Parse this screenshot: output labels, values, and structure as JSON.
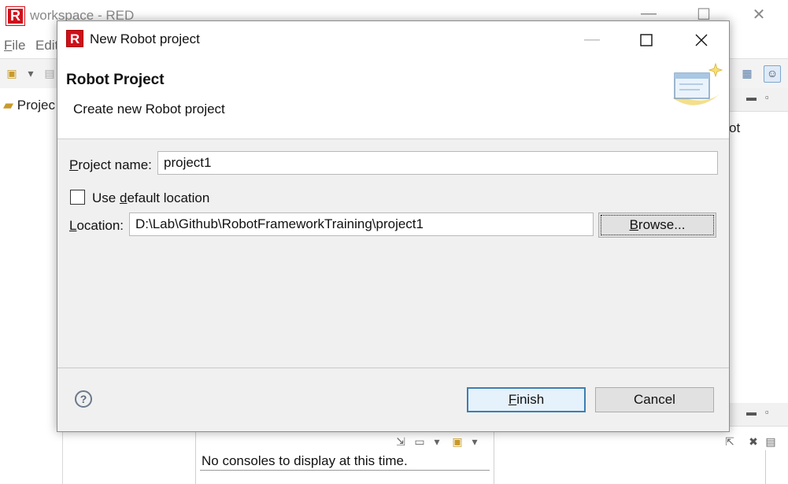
{
  "background_window": {
    "logo_letter": "R",
    "title": "workspace - RED",
    "menu": [
      {
        "label": "File",
        "ul": "F",
        "rest": "ile"
      },
      {
        "label": "Edit",
        "ul": "",
        "rest": "Edit"
      }
    ],
    "left_panel_tab": "Projec",
    "right_panel_text": "ot",
    "console_message": "No consoles to display at this time."
  },
  "dialog": {
    "logo_letter": "R",
    "title": "New Robot project",
    "header_title": "Robot Project",
    "header_description": "Create new Robot project",
    "project_name": {
      "label_ul": "P",
      "label_rest": "roject name:",
      "value": "project1"
    },
    "use_default_location": {
      "label_pre": "Use ",
      "label_ul": "d",
      "label_rest": "efault location",
      "checked": false
    },
    "location": {
      "label_ul": "L",
      "label_rest": "ocation:",
      "value": "D:\\Lab\\Github\\RobotFrameworkTraining\\project1"
    },
    "browse_button": {
      "ul": "B",
      "rest": "rowse..."
    },
    "finish_button": {
      "ul": "F",
      "rest": "inish"
    },
    "cancel_button": "Cancel",
    "help_glyph": "?"
  },
  "icons": {
    "minimize": "minimize-icon",
    "maximize": "maximize-icon",
    "close": "close-icon",
    "help": "help-icon",
    "wizard_banner": "new-project-wizard-icon"
  },
  "colors": {
    "brand_red": "#d0101a",
    "default_button_border": "#3c7fb1",
    "default_button_fill": "#e5f1fb"
  }
}
